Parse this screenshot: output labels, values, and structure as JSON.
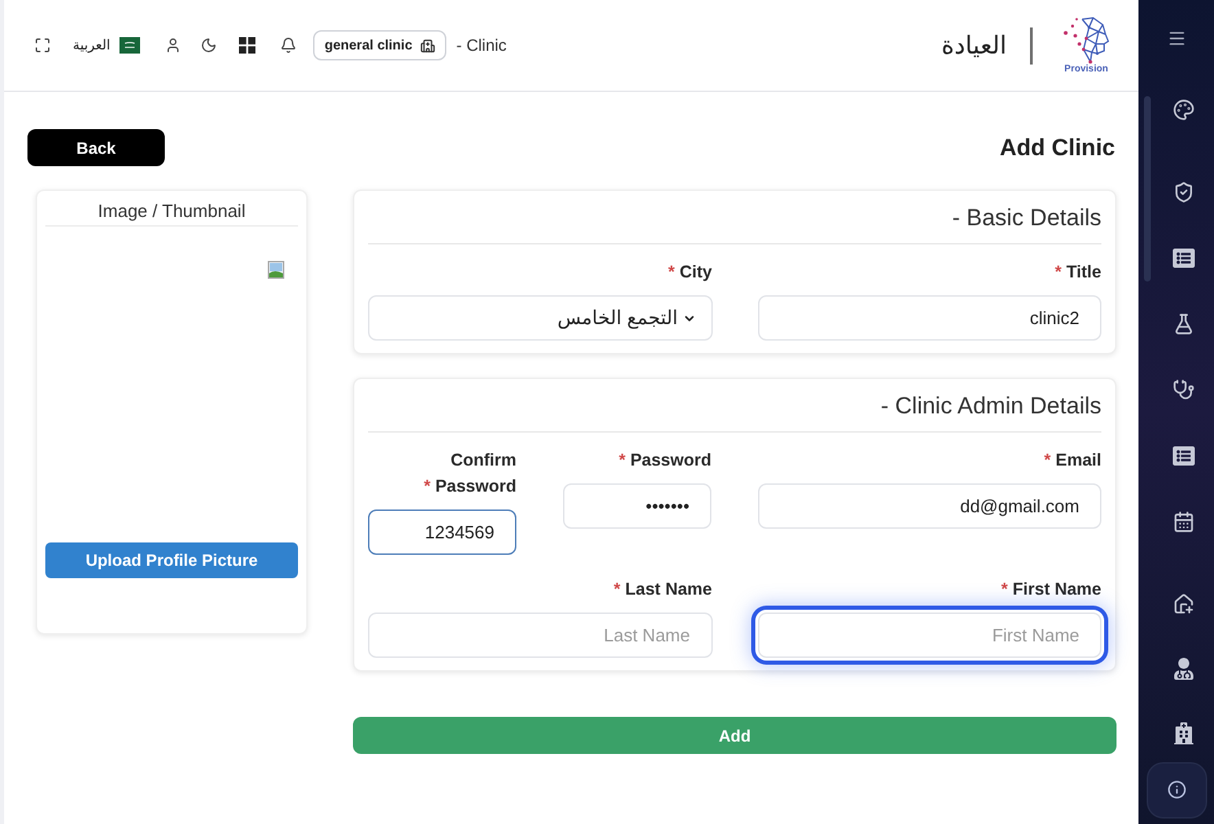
{
  "header": {
    "breadcrumb": "- Clinic",
    "clinic_selector": "general clinic",
    "language": "العربية",
    "title": "العيادة",
    "logo_text": "Provision"
  },
  "sidebar": {
    "groups": [
      {
        "items": [
          {
            "kind": "palette",
            "selected": false
          }
        ]
      },
      {
        "items": [
          {
            "kind": "shield-check",
            "selected": false
          },
          {
            "kind": "list",
            "selected": false
          },
          {
            "kind": "flask",
            "selected": false
          },
          {
            "kind": "stethoscope",
            "selected": false
          },
          {
            "kind": "list",
            "selected": false
          },
          {
            "kind": "calendar",
            "selected": false
          }
        ]
      },
      {
        "items": [
          {
            "kind": "house-plus",
            "selected": false
          },
          {
            "kind": "doctor",
            "selected": false
          },
          {
            "kind": "hospital",
            "selected": false
          }
        ]
      }
    ]
  },
  "page": {
    "title": "Add Clinic",
    "back_button": "Back"
  },
  "image_card": {
    "title": "Image / Thumbnail",
    "upload_button": "Upload Profile Picture"
  },
  "sections": [
    {
      "title": "- Basic Details",
      "rows": [
        {
          "fields": [
            {
              "kind": "select",
              "label": "City",
              "required_mark": "*",
              "value": "التجمع الخامس",
              "focused": false,
              "highlighted": false
            },
            {
              "kind": "text",
              "label": "Title",
              "required_mark": "*",
              "value": "clinic2",
              "focused": false,
              "highlighted": false
            }
          ]
        }
      ]
    },
    {
      "title": "- Clinic Admin Details",
      "rows": [
        {
          "fields": [
            {
              "kind": "password",
              "label": "Confirm Password",
              "required_mark": "*",
              "value": "1234569",
              "focused": false,
              "highlighted": true
            },
            {
              "kind": "password",
              "label": "Password",
              "required_mark": "*",
              "value": "•••••••",
              "focused": false,
              "highlighted": false
            },
            {
              "kind": "text",
              "label": "Email",
              "required_mark": "*",
              "value": "dd@gmail.com",
              "focused": false,
              "highlighted": false
            }
          ]
        },
        {
          "fields": [
            {
              "kind": "text",
              "label": "Last Name",
              "required_mark": "*",
              "placeholder": "Last Name",
              "focused": false,
              "highlighted": false
            },
            {
              "kind": "text",
              "label": "First Name",
              "required_mark": "*",
              "placeholder": "First Name",
              "focused": true,
              "highlighted": false
            }
          ]
        }
      ]
    }
  ],
  "add_button": "Add"
}
